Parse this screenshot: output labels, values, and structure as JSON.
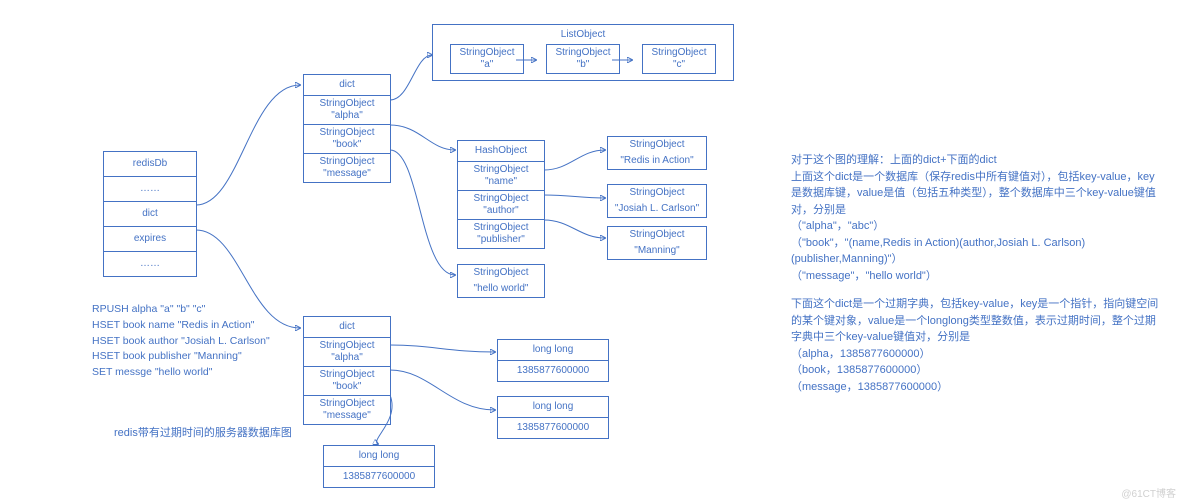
{
  "redisDb": {
    "rows": [
      "redisDb",
      "……",
      "dict",
      "expires",
      "……"
    ]
  },
  "dict_top": {
    "rows": [
      "dict",
      "StringObject\n\"alpha\"",
      "StringObject\n\"book\"",
      "StringObject\n\"message\""
    ]
  },
  "dict_bottom": {
    "rows": [
      "dict",
      "StringObject\n\"alpha\"",
      "StringObject\n\"book\"",
      "StringObject\n\"message\""
    ]
  },
  "listObject": {
    "title": "ListObject",
    "items": [
      {
        "l1": "StringObject",
        "l2": "\"a\""
      },
      {
        "l1": "StringObject",
        "l2": "\"b\""
      },
      {
        "l1": "StringObject",
        "l2": "\"c\""
      }
    ]
  },
  "hashObject": {
    "rows": [
      "HashObject",
      "StringObject\n\"name\"",
      "StringObject\n\"author\"",
      "StringObject\n\"publisher\""
    ]
  },
  "hashValues": {
    "v1": {
      "l1": "StringObject",
      "l2": "\"Redis in Action\""
    },
    "v2": {
      "l1": "StringObject",
      "l2": "\"Josiah L. Carlson\""
    },
    "v3": {
      "l1": "StringObject",
      "l2": "\"Manning\""
    }
  },
  "hello": {
    "l1": "StringObject",
    "l2": "\"hello world\""
  },
  "ll1": {
    "l1": "long long",
    "l2": "1385877600000"
  },
  "ll2": {
    "l1": "long long",
    "l2": "1385877600000"
  },
  "ll3": {
    "l1": "long long",
    "l2": "1385877600000"
  },
  "commands": {
    "c1": "RPUSH  alpha  \"a\" \"b\" \"c\"",
    "c2": "HSET book name  \"Redis in Action\"",
    "c3": "HSET book author \"Josiah L. Carlson\"",
    "c4": "HSET book publisher  \"Manning\"",
    "c5": "SET messge \"hello world\""
  },
  "caption": "redis带有过期时间的服务器数据库图",
  "explain_top": {
    "p1": "对于这个图的理解：上面的dict+下面的dict",
    "p2": "上面这个dict是一个数据库（保存redis中所有键值对），包括key-value，key是数据库键，value是值（包括五种类型），整个数据库中三个key-value键值对，分别是",
    "p3": "（\"alpha\"，\"abc\"）",
    "p4": "（\"book\"，\"(name,Redis in Action)(author,Josiah L. Carlson)(publisher,Manning)\"）",
    "p5": "（\"message\"，\"hello world\"）"
  },
  "explain_bottom": {
    "p1": "下面这个dict是一个过期字典，包括key-value，key是一个指针，指向键空间的某个键对象，value是一个longlong类型整数值，表示过期时间，整个过期字典中三个key-value键值对，分别是",
    "p2": "（alpha，1385877600000）",
    "p3": "（book，1385877600000）",
    "p4": "（message，1385877600000）"
  },
  "watermark": "@61CT博客",
  "chart_data": {
    "type": "diagram",
    "title": "redis带有过期时间的服务器数据库图",
    "redisDb": [
      "dict",
      "expires"
    ],
    "database_dict": {
      "alpha": {
        "type": "ListObject",
        "items": [
          "a",
          "b",
          "c"
        ]
      },
      "book": {
        "type": "HashObject",
        "fields": {
          "name": "Redis in Action",
          "author": "Josiah L. Carlson",
          "publisher": "Manning"
        }
      },
      "message": {
        "type": "StringObject",
        "value": "hello world"
      }
    },
    "expires_dict": {
      "alpha": 1385877600000,
      "book": 1385877600000,
      "message": 1385877600000
    },
    "commands": [
      "RPUSH alpha \"a\" \"b\" \"c\"",
      "HSET book name \"Redis in Action\"",
      "HSET book author \"Josiah L. Carlson\"",
      "HSET book publisher \"Manning\"",
      "SET messge \"hello world\""
    ]
  }
}
